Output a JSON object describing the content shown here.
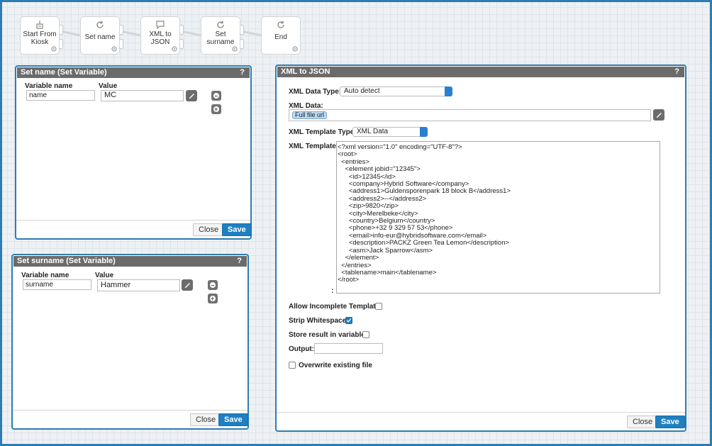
{
  "workflow": {
    "nodes": [
      {
        "label": "Start From Kiosk",
        "icon": "kiosk-icon"
      },
      {
        "label": "Set name",
        "icon": "refresh-icon"
      },
      {
        "label": "XML to JSON",
        "icon": "speech-bubble-icon"
      },
      {
        "label": "Set surname",
        "icon": "refresh-icon"
      },
      {
        "label": "End",
        "icon": "refresh-icon"
      }
    ]
  },
  "set_name": {
    "title": "Set name (Set Variable)",
    "help": "?",
    "var_name_label": "Variable name",
    "value_label": "Value",
    "var_name": "name",
    "value": "MC",
    "close": "Close",
    "save": "Save"
  },
  "set_surname": {
    "title": "Set surname (Set Variable)",
    "help": "?",
    "var_name_label": "Variable name",
    "value_label": "Value",
    "var_name": "surname",
    "value": "Hammer",
    "close": "Close",
    "save": "Save"
  },
  "xml_to_json": {
    "title": "XML to JSON",
    "help": "?",
    "data_type_label": "XML Data Type:",
    "data_type_value": "Auto detect",
    "data_label": "XML Data:",
    "data_chip": "Full file url",
    "template_type_label": "XML Template Type:",
    "template_type_value": "XML Data",
    "template_label": "XML Template",
    "template_colon": ":",
    "template_lines": [
      "<?xml version=\"1.0\" encoding=\"UTF-8\"?>",
      "<root>",
      "  <entries>",
      "    <element jobid=\"12345\">",
      "      <id>12345</id>",
      "      <company>Hybrid Software</company>",
      "      <address1>Guldensporenpark 18 block B</address1>",
      "      <address2>--</address2>",
      "      <zip>9820</zip>",
      "      <city>Merelbeke</city>",
      "      <country>Belgium</country>",
      "      <phone>+32 9 329 57 53</phone>",
      "      <email>info-eur@hybridsoftware.com</email>",
      "      <description>PACKZ Green Tea Lemon</description>",
      "      <asm>Jack Sparrow</asm>",
      "    </element>",
      "  </entries>",
      "  <tablename>main</tablename>",
      "</root>"
    ],
    "allow_incomplete_label": "Allow Incomplete Template:",
    "allow_incomplete": false,
    "strip_ws_label": "Strip Whitespace:",
    "strip_ws": true,
    "store_label": "Store result in variable:",
    "store": false,
    "output_label": "Output:",
    "output_value": "",
    "overwrite_label": "Overwrite existing file",
    "overwrite": false,
    "close": "Close",
    "save": "Save"
  },
  "colors": {
    "accent": "#2d7db3",
    "title_bar": "#6b6b6b",
    "save_button": "#1f7fc1"
  }
}
